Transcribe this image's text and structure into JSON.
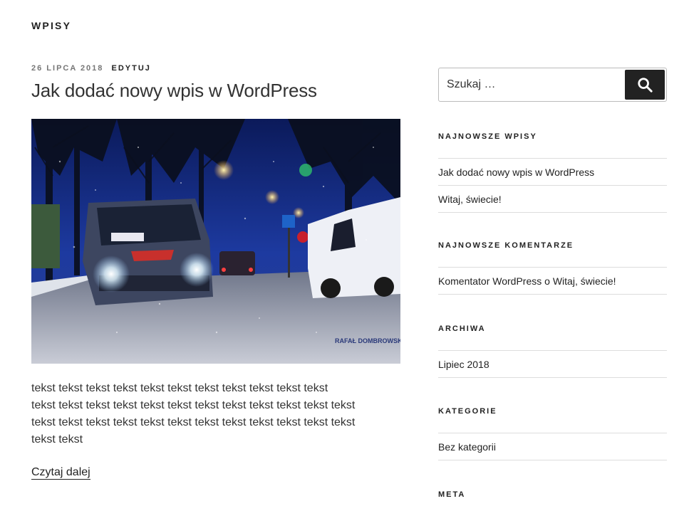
{
  "header": {
    "title": "WPISY"
  },
  "post": {
    "date": "26 LIPCA 2018",
    "edit_label": "EDYTUJ",
    "title": "Jak dodać nowy wpis w WordPress",
    "image_watermark": "RAFAŁ DOMBROWSKI",
    "excerpt_lines": [
      "tekst tekst tekst tekst tekst tekst tekst tekst tekst tekst tekst",
      "tekst tekst tekst tekst tekst tekst tekst tekst tekst tekst tekst tekst",
      "tekst tekst tekst tekst tekst tekst tekst tekst tekst tekst tekst tekst",
      "tekst tekst"
    ],
    "read_more": "Czytaj dalej"
  },
  "sidebar": {
    "search": {
      "placeholder": "Szukaj …",
      "icon": "search-icon"
    },
    "widgets": {
      "recent_posts": {
        "title": "NAJNOWSZE WPISY",
        "items": [
          "Jak dodać nowy wpis w WordPress",
          "Witaj, świecie!"
        ]
      },
      "recent_comments": {
        "title": "NAJNOWSZE KOMENTARZE",
        "items": [
          {
            "author": "Komentator WordPress",
            "connector": " o ",
            "post": "Witaj, świecie!"
          }
        ]
      },
      "archives": {
        "title": "ARCHIWA",
        "items": [
          "Lipiec 2018"
        ]
      },
      "categories": {
        "title": "KATEGORIE",
        "items": [
          "Bez kategorii"
        ]
      },
      "meta": {
        "title": "META"
      }
    }
  },
  "colors": {
    "text": "#222222",
    "meta_gray": "#767676",
    "search_button": "#222222",
    "divider": "#dddddd"
  }
}
